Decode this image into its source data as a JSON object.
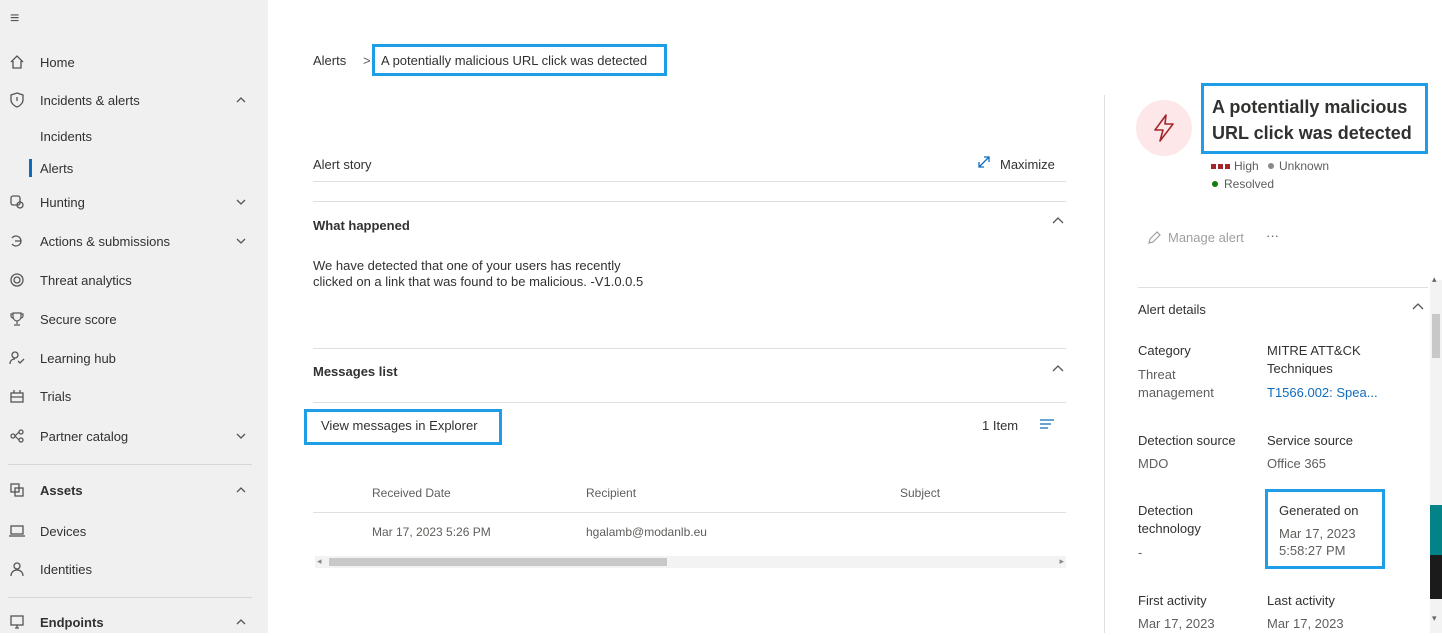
{
  "sidebar": {
    "items": [
      {
        "label": "Home",
        "icon": "home-icon"
      },
      {
        "label": "Incidents & alerts",
        "icon": "shield-icon"
      },
      {
        "label": "Incidents"
      },
      {
        "label": "Alerts"
      },
      {
        "label": "Hunting",
        "icon": "hunting-icon"
      },
      {
        "label": "Actions & submissions",
        "icon": "actions-icon"
      },
      {
        "label": "Threat analytics",
        "icon": "threat-analytics-icon"
      },
      {
        "label": "Secure score",
        "icon": "trophy-icon"
      },
      {
        "label": "Learning hub",
        "icon": "learning-icon"
      },
      {
        "label": "Trials",
        "icon": "trials-icon"
      },
      {
        "label": "Partner catalog",
        "icon": "partner-icon"
      },
      {
        "label": "Assets",
        "icon": "assets-icon"
      },
      {
        "label": "Devices",
        "icon": "devices-icon"
      },
      {
        "label": "Identities",
        "icon": "person-icon"
      },
      {
        "label": "Endpoints",
        "icon": "endpoints-icon"
      }
    ]
  },
  "breadcrumb": {
    "root": "Alerts",
    "separator": ">",
    "current": "A potentially malicious URL click was detected"
  },
  "main": {
    "alert_story": "Alert story",
    "maximize": "Maximize",
    "what_happened_title": "What happened",
    "what_happened_line1": "We have detected that one of your users has recently",
    "what_happened_line2": "clicked on a link that was found to be malicious. -V1.0.0.5",
    "messages_title": "Messages list",
    "view_messages": "View messages in Explorer",
    "item_count": "1 Item",
    "table": {
      "headers": [
        "Received Date",
        "Recipient",
        "Subject"
      ],
      "rows": [
        [
          "Mar 17, 2023 5:26 PM",
          "hgalamb@modanlb.eu",
          ""
        ]
      ]
    }
  },
  "panel": {
    "title_line1": "A potentially malicious",
    "title_line2": "URL click was detected",
    "severity": "High",
    "status_unknown": "Unknown",
    "status_resolved": "Resolved",
    "manage_alert": "Manage alert",
    "more": "···",
    "details_title": "Alert details",
    "category_label": "Category",
    "category_value_1": "Threat",
    "category_value_2": "management",
    "mitre_label_1": "MITRE ATT&CK",
    "mitre_label_2": "Techniques",
    "mitre_value": "T1566.002: Spea...",
    "detection_source_label": "Detection source",
    "detection_source_value": "MDO",
    "service_source_label": "Service source",
    "service_source_value": "Office 365",
    "detection_tech_label_1": "Detection",
    "detection_tech_label_2": "technology",
    "detection_tech_value": "-",
    "generated_label": "Generated on",
    "generated_value_1": "Mar 17, 2023",
    "generated_value_2": "5:58:27 PM",
    "first_activity_label": "First activity",
    "first_activity_value": "Mar 17, 2023",
    "last_activity_label": "Last activity",
    "last_activity_value": "Mar 17, 2023"
  },
  "colors": {
    "highlight": "#1e9ee6",
    "link": "#0f6cbd",
    "severity_high": "#a4262c",
    "resolved": "#107c10",
    "unknown": "#8a8886"
  }
}
